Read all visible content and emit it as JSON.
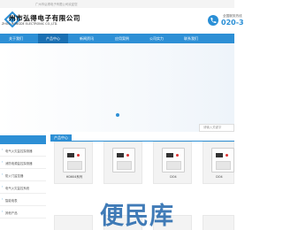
{
  "topbar": {
    "text": "广州市弘得电子有限公司欢迎您"
  },
  "header": {
    "company_cn": "州市弘得电子有限公司",
    "company_en": "ZHOU HONGDE ELECTRONIC CO.,LTD.",
    "hotline_label": "全国服务热线",
    "hotline_number": "020-3"
  },
  "nav": {
    "items": [
      {
        "label": "关于我们"
      },
      {
        "label": "产品中心"
      },
      {
        "label": "新闻资讯"
      },
      {
        "label": "应用案例"
      },
      {
        "label": "公司实力"
      },
      {
        "label": "联系我们"
      }
    ],
    "active_index": 1
  },
  "search": {
    "placeholder": "请输入关键字"
  },
  "sidebar": {
    "items": [
      {
        "label": "电气火灾监控探测器"
      },
      {
        "label": "消防电源监控探测器"
      },
      {
        "label": "防火门监控器"
      },
      {
        "label": "电气火灾监控系统"
      },
      {
        "label": "智能电表"
      },
      {
        "label": "其他产品"
      }
    ]
  },
  "products": {
    "section_title": "产品中心",
    "items": [
      {
        "label": "HD604系列"
      },
      {
        "label": ""
      },
      {
        "label": "DO4"
      },
      {
        "label": "DO4"
      }
    ]
  },
  "watermark": "便民库",
  "colors": {
    "brand": "#2d8fd5",
    "nav_active": "#1a6fb2"
  }
}
